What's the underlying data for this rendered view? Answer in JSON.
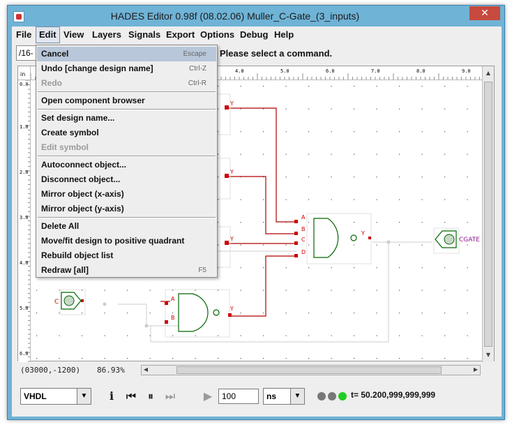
{
  "window": {
    "title": "HADES Editor 0.98f (08.02.06)   Muller_C-Gate_(3_inputs)",
    "close_symbol": "✕"
  },
  "menubar": {
    "items": [
      "File",
      "Edit",
      "View",
      "Layers",
      "Signals",
      "Export",
      "Options",
      "Debug",
      "Help"
    ]
  },
  "toolbar": {
    "path_value": "/16-",
    "status_message": "Please select a command."
  },
  "edit_menu": {
    "items": [
      {
        "label": "Cancel",
        "accel": "Escape",
        "enabled": true,
        "selected": true
      },
      {
        "label": "Undo [change design name]",
        "accel": "Ctrl-Z",
        "enabled": true
      },
      {
        "label": "Redo",
        "accel": "Ctrl-R",
        "enabled": false
      },
      {
        "label": "Open component browser",
        "accel": "",
        "enabled": true
      },
      {
        "label": "Set design name...",
        "accel": "",
        "enabled": true
      },
      {
        "label": "Create symbol",
        "accel": "",
        "enabled": true
      },
      {
        "label": "Edit symbol",
        "accel": "",
        "enabled": false
      },
      {
        "label": "Autoconnect object...",
        "accel": "",
        "enabled": true
      },
      {
        "label": "Disconnect object...",
        "accel": "",
        "enabled": true
      },
      {
        "label": "Mirror object (x-axis)",
        "accel": "",
        "enabled": true
      },
      {
        "label": "Mirror object (y-axis)",
        "accel": "",
        "enabled": true
      },
      {
        "label": "Delete All",
        "accel": "",
        "enabled": true
      },
      {
        "label": "Move/fit design to positive quadrant",
        "accel": "",
        "enabled": true
      },
      {
        "label": "Rebuild object list",
        "accel": "",
        "enabled": true
      },
      {
        "label": "Redraw [all]",
        "accel": "F5",
        "enabled": true
      }
    ]
  },
  "rulers": {
    "unit": "in",
    "h_ticks": [
      "4.0",
      "5.0",
      "6.0",
      "7.0",
      "8.0",
      "9.0"
    ],
    "v_ticks": [
      "0.0",
      "1.0",
      "2.0",
      "3.0",
      "4.0",
      "5.0",
      "6.0"
    ]
  },
  "schematic": {
    "gate_pins": [
      "A",
      "B",
      "C",
      "D"
    ],
    "output_pin": "Y",
    "input_label": "C",
    "output_label": "CGATE",
    "wire_color": "#b00000",
    "gate_color": "#006600",
    "label_color": "#cc0000",
    "output_label_color": "#8a1d8a"
  },
  "statusbar": {
    "coordinates": "(03000,-1200)",
    "zoom": "86.93%"
  },
  "simbar": {
    "language": "VHDL",
    "time_value": "100",
    "time_unit": "ns",
    "sim_time": "t= 50.200,999,999,999",
    "led_colors": [
      "#777777",
      "#777777",
      "#22cc22"
    ]
  }
}
